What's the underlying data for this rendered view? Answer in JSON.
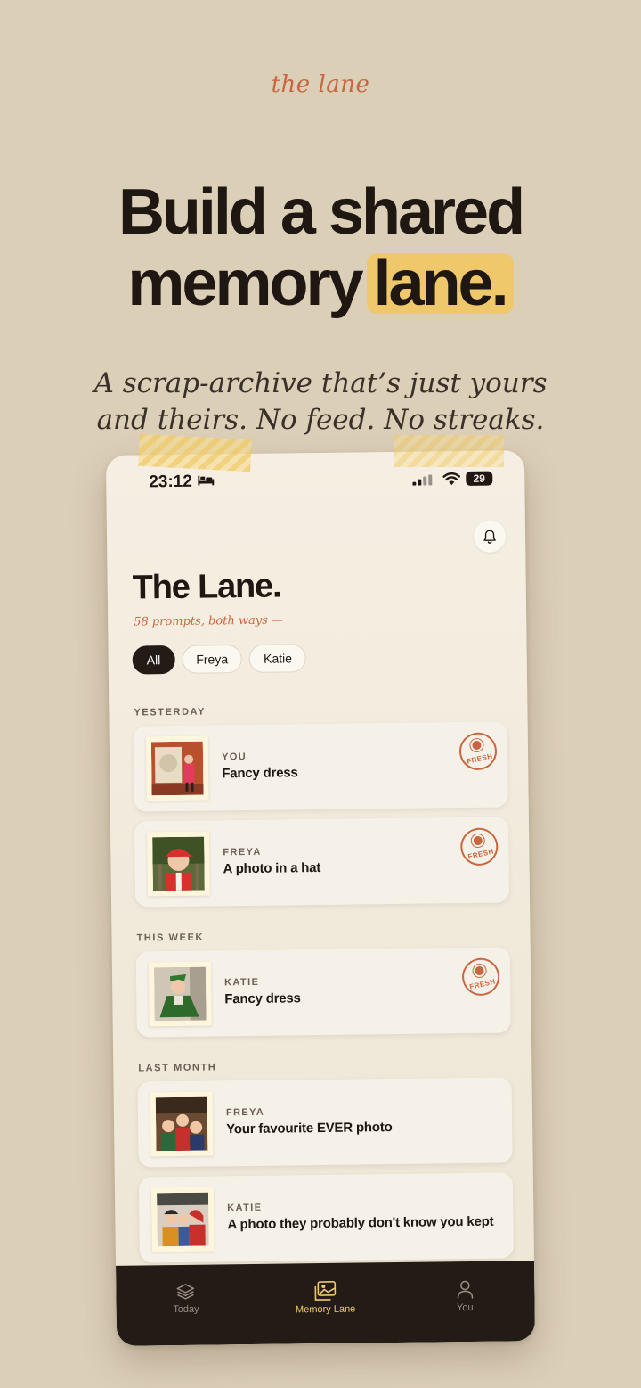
{
  "brand": "the lane",
  "headline": {
    "line1": "Build a shared",
    "line2_pre": "memory",
    "line2_mark": "lane."
  },
  "tagline": {
    "line1": "A scrap-archive that’s just yours",
    "line2": "and theirs. No feed. No streaks."
  },
  "status_bar": {
    "time": "23:12",
    "battery": "29"
  },
  "screen": {
    "title": "The Lane.",
    "subtitle": "58 prompts, both ways —",
    "filters": [
      {
        "label": "All",
        "active": true
      },
      {
        "label": "Freya",
        "active": false
      },
      {
        "label": "Katie",
        "active": false
      }
    ]
  },
  "sections": {
    "yesterday": "YESTERDAY",
    "this_week": "THIS WEEK",
    "last_month": "LAST MONTH"
  },
  "cards": [
    {
      "who": "YOU",
      "title": "Fancy dress",
      "fresh": true
    },
    {
      "who": "FREYA",
      "title": "A photo in a hat",
      "fresh": true
    },
    {
      "who": "KATIE",
      "title": "Fancy dress",
      "fresh": true
    },
    {
      "who": "FREYA",
      "title": "Your favourite EVER photo",
      "fresh": false
    },
    {
      "who": "KATIE",
      "title": "A photo they probably don't know you kept",
      "fresh": false
    }
  ],
  "fresh_label": "FRESH",
  "nav": [
    {
      "label": "Today",
      "icon": "layers-icon",
      "active": false
    },
    {
      "label": "Memory Lane",
      "icon": "photo-gallery-icon",
      "active": true
    },
    {
      "label": "You",
      "icon": "person-icon",
      "active": false
    }
  ],
  "colors": {
    "background": "#dccfb8",
    "accent": "#c8663f",
    "highlight": "#eec86a",
    "dark": "#231b16"
  }
}
